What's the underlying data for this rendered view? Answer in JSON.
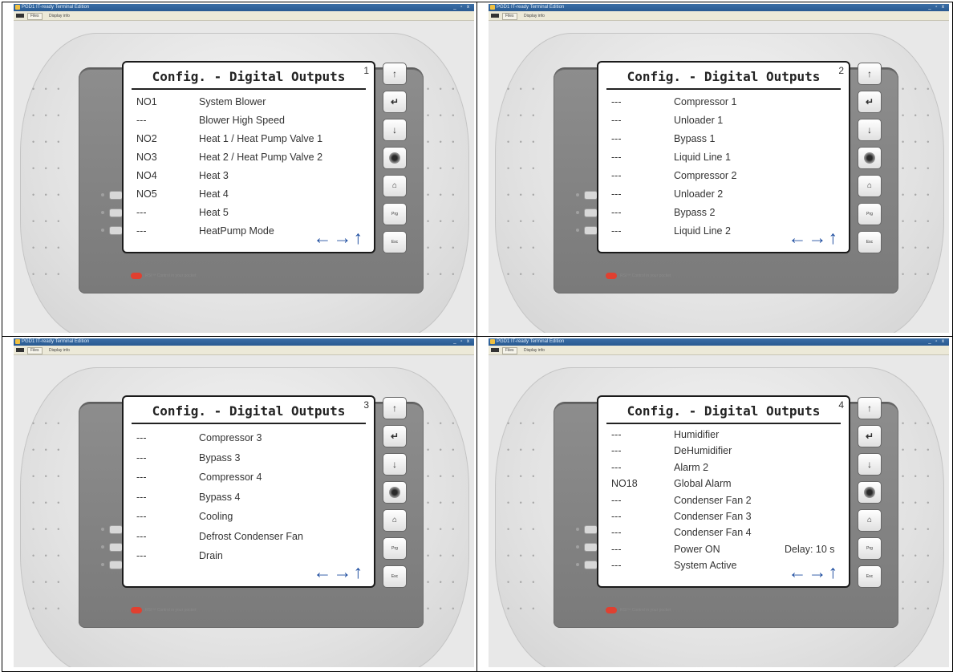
{
  "window": {
    "title": "PGD1 IT-ready Terminal Edition",
    "controls": "_ ▫ x",
    "menu": [
      "Files",
      "Display info"
    ]
  },
  "colors": {
    "titlebar": "#3a6ea5",
    "nav_arrows": "#1f4ea0",
    "logo": "#e04030"
  },
  "brand_text": "RSI™ Control in your pocket",
  "nav_arrows": "←→↑",
  "key_labels": [
    "↑",
    "↵",
    "↓",
    "gear",
    "home",
    "Prg",
    "Esc"
  ],
  "icons": {
    "prg": "prg-key-icon",
    "esc": "esc-key-icon",
    "home": "home-icon",
    "gear": "knob-icon"
  },
  "screens": [
    {
      "title": "Config. - Digital Outputs",
      "page": "1",
      "rows": [
        {
          "code": "NO1",
          "label": "System Blower"
        },
        {
          "code": "---",
          "label": "Blower High Speed"
        },
        {
          "code": "NO2",
          "label": "Heat 1 / Heat Pump Valve 1"
        },
        {
          "code": "NO3",
          "label": "Heat 2 / Heat Pump Valve 2"
        },
        {
          "code": "NO4",
          "label": "Heat 3"
        },
        {
          "code": "NO5",
          "label": "Heat 4"
        },
        {
          "code": "---",
          "label": "Heat 5"
        },
        {
          "code": "---",
          "label": "HeatPump Mode"
        }
      ]
    },
    {
      "title": "Config. - Digital Outputs",
      "page": "2",
      "rows": [
        {
          "code": "---",
          "label": "Compressor 1"
        },
        {
          "code": "---",
          "label": "Unloader 1"
        },
        {
          "code": "---",
          "label": "Bypass 1"
        },
        {
          "code": "---",
          "label": "Liquid Line 1"
        },
        {
          "code": "---",
          "label": "Compressor 2"
        },
        {
          "code": "---",
          "label": "Unloader 2"
        },
        {
          "code": "---",
          "label": "Bypass 2"
        },
        {
          "code": "---",
          "label": "Liquid Line 2"
        }
      ]
    },
    {
      "title": "Config. - Digital Outputs",
      "page": "3",
      "rows": [
        {
          "code": "---",
          "label": "Compressor 3"
        },
        {
          "code": "---",
          "label": "Bypass 3"
        },
        {
          "code": "---",
          "label": "Compressor 4"
        },
        {
          "code": "---",
          "label": "Bypass 4"
        },
        {
          "code": "---",
          "label": "Cooling"
        },
        {
          "code": "---",
          "label": "Defrost Condenser Fan"
        },
        {
          "code": "---",
          "label": "Drain"
        }
      ]
    },
    {
      "title": "Config. - Digital Outputs",
      "page": "4",
      "rows": [
        {
          "code": "---",
          "label": "Humidifier"
        },
        {
          "code": "---",
          "label": "DeHumidifier"
        },
        {
          "code": "---",
          "label": "Alarm 2"
        },
        {
          "code": "NO18",
          "label": "Global Alarm"
        },
        {
          "code": "---",
          "label": "Condenser Fan 2"
        },
        {
          "code": "---",
          "label": "Condenser Fan 3"
        },
        {
          "code": "---",
          "label": "Condenser Fan 4"
        },
        {
          "code": "---",
          "label": "Power ON",
          "delay": "Delay:  10 s"
        },
        {
          "code": "---",
          "label": "System Active"
        }
      ]
    }
  ]
}
